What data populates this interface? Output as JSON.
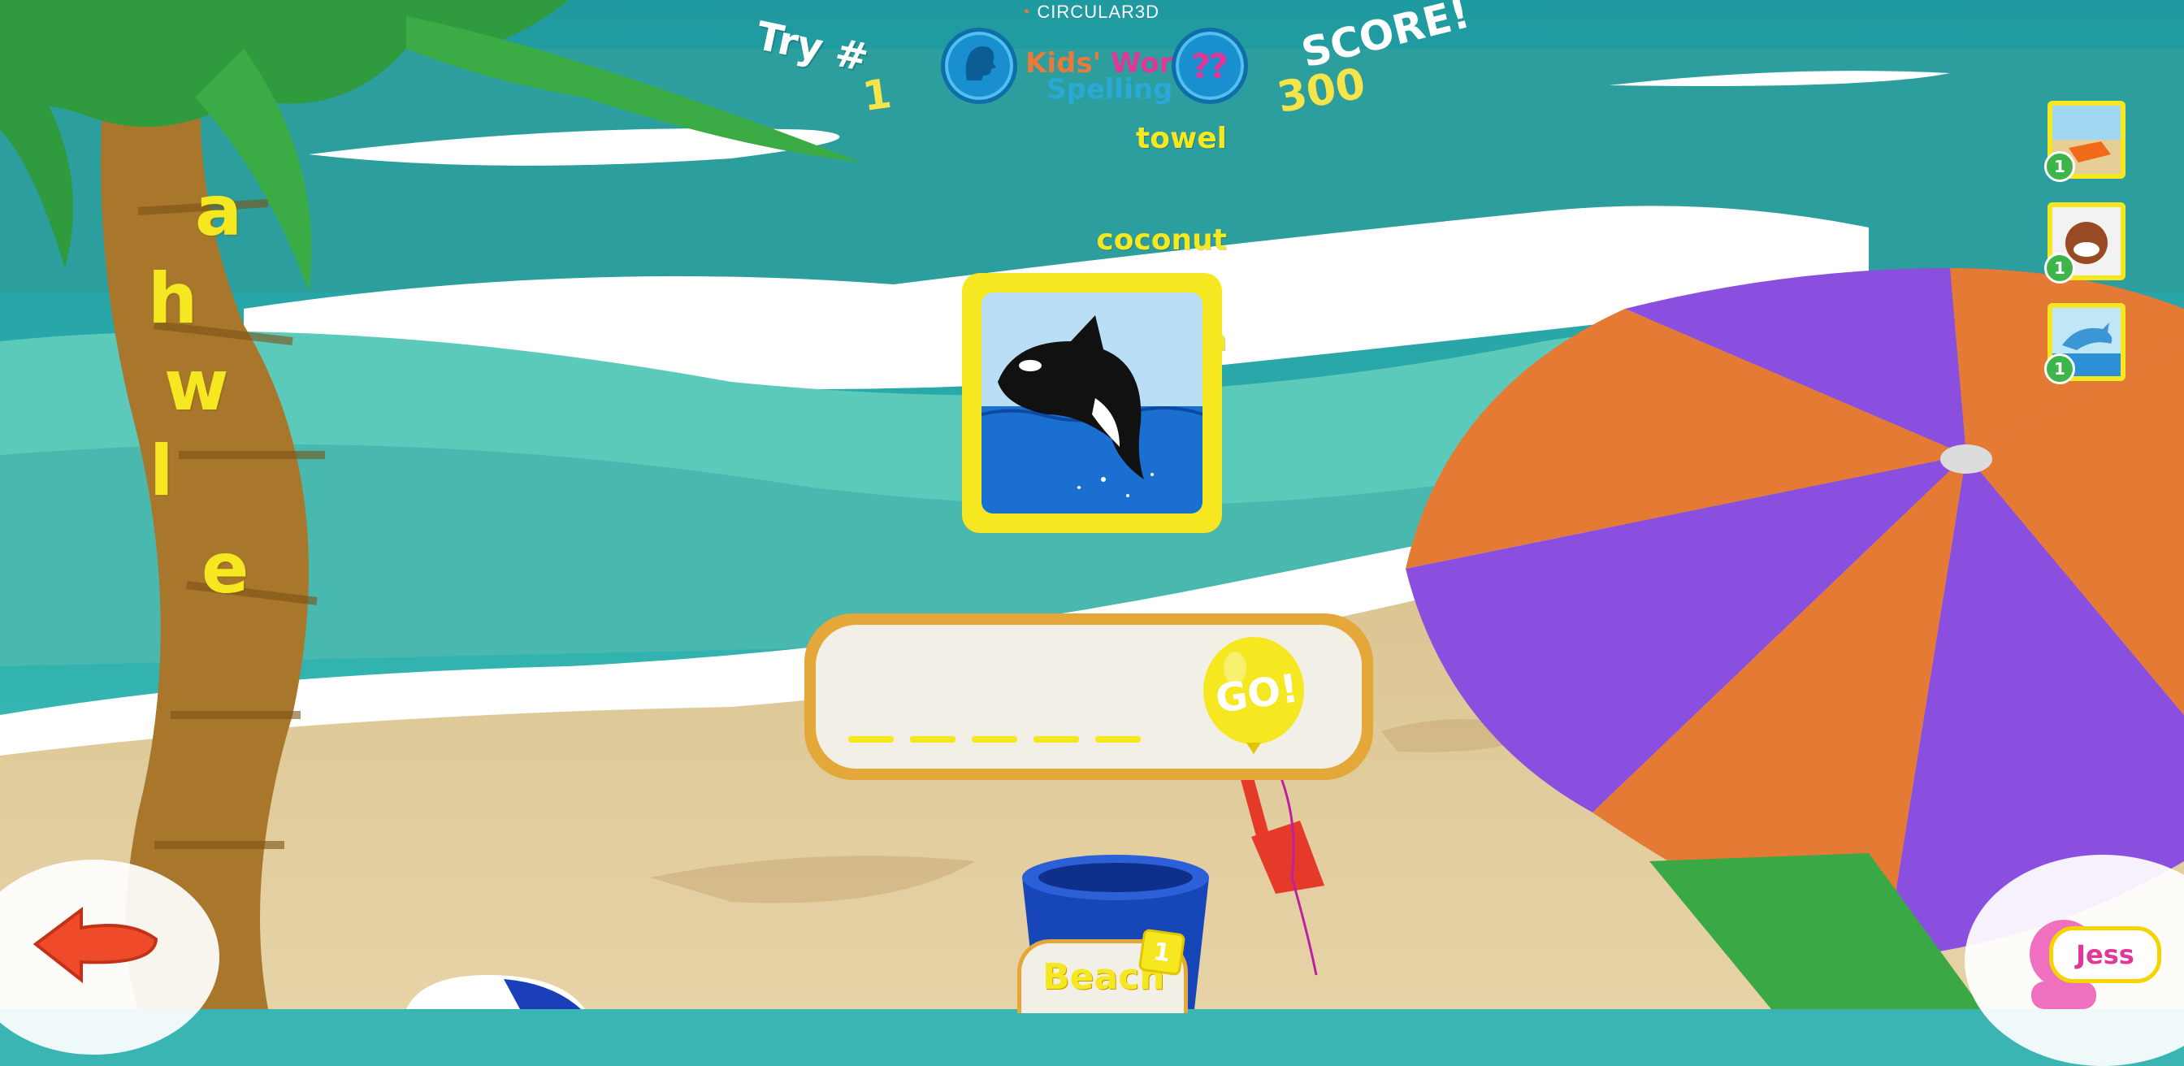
{
  "header": {
    "brand": "CIRCULAR3D",
    "logo_line1_a": "Kids'",
    "logo_line1_b": "Words",
    "logo_line2": "Spelling",
    "try_label": "Try #",
    "try_number": "1",
    "score_label": "SCORE!",
    "score_value": "300",
    "speak_icon": "speaking-head-icon",
    "help_icon": "question-mark-icon"
  },
  "letters": [
    "a",
    "h",
    "w",
    "l",
    "e"
  ],
  "side_words": [
    {
      "word": "towel",
      "count": "1",
      "icon": "towel-icon"
    },
    {
      "word": "coconut",
      "count": "1",
      "icon": "coconut-icon"
    },
    {
      "word": "dolphin",
      "count": "1",
      "icon": "dolphin-icon"
    }
  ],
  "picture": {
    "icon": "orca-whale-icon"
  },
  "answer": {
    "blank_count": 5,
    "go_label": "GO!"
  },
  "footer": {
    "category": "Beach",
    "category_count": "1",
    "user_name": "Jess",
    "back_icon": "back-arrow-icon"
  },
  "colors": {
    "accent_yellow": "#f5e820",
    "answer_border": "#e3a73a",
    "umbrella_orange": "#e57a35",
    "umbrella_purple": "#8b4fe0",
    "sea": "#3bb4b4"
  }
}
